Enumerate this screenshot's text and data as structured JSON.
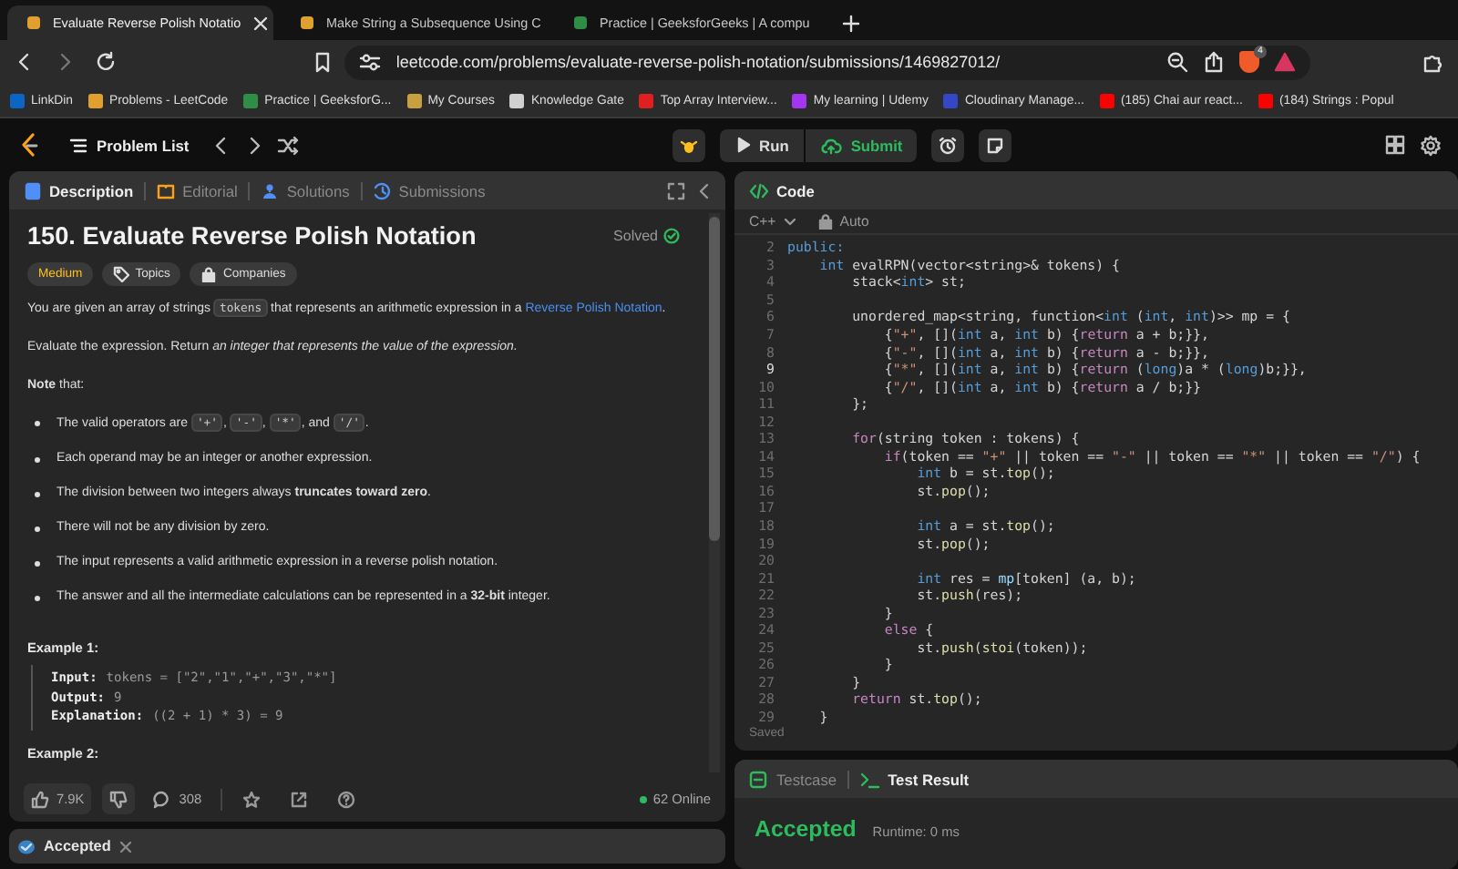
{
  "browser": {
    "tabs": [
      {
        "title": "Evaluate Reverse Polish Notatio",
        "selected": true,
        "color": "#e0a030"
      },
      {
        "title": "Make String a Subsequence Using C",
        "selected": false,
        "color": "#e0a030"
      },
      {
        "title": "Practice | GeeksforGeeks | A compu",
        "selected": false,
        "color": "#2f8d46"
      }
    ],
    "address": "leetcode.com/problems/evaluate-reverse-polish-notation/submissions/1469827012/",
    "shield_badge": "4",
    "bookmarks": [
      {
        "label": "LinkDin",
        "color": "#0a66c2"
      },
      {
        "label": "Problems - LeetCode",
        "color": "#e0a030"
      },
      {
        "label": "Practice | GeeksforG...",
        "color": "#2f8d46"
      },
      {
        "label": "My Courses",
        "color": "#c8a040"
      },
      {
        "label": "Knowledge Gate",
        "color": "#d0d0d0"
      },
      {
        "label": "Top Array Interview...",
        "color": "#e02020"
      },
      {
        "label": "My learning | Udemy",
        "color": "#a435f0"
      },
      {
        "label": "Cloudinary Manage...",
        "color": "#3448c5"
      },
      {
        "label": "(185) Chai aur react...",
        "color": "#ff0000"
      },
      {
        "label": "(184) Strings : Popul",
        "color": "#ff0000"
      }
    ]
  },
  "app_bar": {
    "problem_list": "Problem List",
    "run": "Run",
    "submit": "Submit"
  },
  "description_panel": {
    "tabs": [
      {
        "label": "Description",
        "selected": true
      },
      {
        "label": "Editorial",
        "selected": false
      },
      {
        "label": "Solutions",
        "selected": false
      },
      {
        "label": "Submissions",
        "selected": false
      }
    ],
    "title": "150. Evaluate Reverse Polish Notation",
    "status": "Solved",
    "tags": [
      {
        "kind": "difficulty",
        "label": "Medium"
      },
      {
        "kind": "topics",
        "label": "Topics"
      },
      {
        "kind": "companies",
        "label": "Companies"
      }
    ],
    "body": [
      {
        "kind": "paragraph",
        "segments": [
          "You are given an array of strings ",
          {
            "kind": "code",
            "text": "tokens"
          },
          " that represents an arithmetic expression in a ",
          {
            "kind": "link",
            "text": "Reverse Polish Notation"
          },
          "."
        ]
      },
      {
        "kind": "paragraph",
        "segments": [
          "Evaluate the expression. Return ",
          {
            "kind": "italic",
            "text": "an integer that represents the value of the expression."
          }
        ]
      },
      {
        "kind": "paragraph",
        "segments": [
          {
            "kind": "bold",
            "text": "Note"
          },
          " that:"
        ]
      },
      {
        "kind": "list",
        "items": [
          [
            "The valid operators are ",
            {
              "kind": "code",
              "text": "'+'"
            },
            ", ",
            {
              "kind": "code",
              "text": "'-'"
            },
            ", ",
            {
              "kind": "code",
              "text": "'*'"
            },
            ", and ",
            {
              "kind": "code",
              "text": "'/'"
            },
            "."
          ],
          [
            "Each operand may be an integer or another expression."
          ],
          [
            "The division between two integers always ",
            {
              "kind": "bold",
              "text": "truncates toward zero"
            },
            "."
          ],
          [
            "There will not be any division by zero."
          ],
          [
            "The input represents a valid arithmetic expression in a reverse polish notation."
          ],
          [
            "The answer and all the intermediate calculations can be represented in a ",
            {
              "kind": "bold",
              "text": "32-bit"
            },
            " integer."
          ]
        ]
      },
      {
        "kind": "heading",
        "text": "Example 1:"
      },
      {
        "kind": "example",
        "lines": [
          {
            "label": "Input:",
            "value": "tokens = [\"2\",\"1\",\"+\",\"3\",\"*\"]"
          },
          {
            "label": "Output:",
            "value": "9"
          },
          {
            "label": "Explanation:",
            "value": "((2 + 1) * 3) = 9"
          }
        ]
      },
      {
        "kind": "heading",
        "text": "Example 2:"
      }
    ],
    "footer": {
      "likes": "7.9K",
      "comments": "308",
      "online": "62 Online"
    }
  },
  "result_tab": {
    "label": "Accepted"
  },
  "code_panel": {
    "title": "Code",
    "language": "C++",
    "mode": "Auto",
    "status": "Saved",
    "lines": [
      {
        "number": "2",
        "current": false,
        "segments": [
          {
            "kind": "kw",
            "text": "public:"
          }
        ]
      },
      {
        "number": "3",
        "current": false,
        "segments": [
          {
            "kind": "kw",
            "text": "    int"
          },
          " evalRPN(",
          {
            "kind": "type",
            "text": "vector"
          },
          "<",
          {
            "kind": "type",
            "text": "string"
          },
          ">& tokens) {"
        ]
      },
      {
        "number": "4",
        "current": false,
        "segments": [
          "        stack<",
          {
            "kind": "kw",
            "text": "int"
          },
          "> st;"
        ]
      },
      {
        "number": "5",
        "current": false
      },
      {
        "number": "6",
        "current": false,
        "segments": [
          "        unordered_map<string, function<",
          {
            "kind": "kw",
            "text": "int"
          },
          " (",
          {
            "kind": "kw",
            "text": "int"
          },
          ", ",
          {
            "kind": "kw",
            "text": "int"
          },
          ")>> mp = {"
        ]
      },
      {
        "number": "7",
        "current": false,
        "segments": [
          "            {",
          {
            "kind": "str",
            "text": "\"+\""
          },
          ", [](",
          {
            "kind": "kw",
            "text": "int"
          },
          " a, ",
          {
            "kind": "kw",
            "text": "int"
          },
          " b) {",
          {
            "kind": "ctl",
            "text": "return"
          },
          " a + b;}},"
        ]
      },
      {
        "number": "8",
        "current": false,
        "segments": [
          "            {",
          {
            "kind": "str",
            "text": "\"-\""
          },
          ", [](",
          {
            "kind": "kw",
            "text": "int"
          },
          " a, ",
          {
            "kind": "kw",
            "text": "int"
          },
          " b) {",
          {
            "kind": "ctl",
            "text": "return"
          },
          " a - b;}},"
        ]
      },
      {
        "number": "9",
        "current": true,
        "segments": [
          "            {",
          {
            "kind": "str",
            "text": "\"*\""
          },
          ", [](",
          {
            "kind": "kw",
            "text": "int"
          },
          " a, ",
          {
            "kind": "kw",
            "text": "int"
          },
          " b) {",
          {
            "kind": "ctl",
            "text": "return"
          },
          " (",
          {
            "kind": "kw",
            "text": "long"
          },
          ")a * (",
          {
            "kind": "kw",
            "text": "long"
          },
          ")b;}},"
        ]
      },
      {
        "number": "10",
        "current": false,
        "segments": [
          "            {",
          {
            "kind": "str",
            "text": "\"/\""
          },
          ", [](",
          {
            "kind": "kw",
            "text": "int"
          },
          " a, ",
          {
            "kind": "kw",
            "text": "int"
          },
          " b) {",
          {
            "kind": "ctl",
            "text": "return"
          },
          " a / b;}}"
        ]
      },
      {
        "number": "11",
        "current": false,
        "segments": [
          "        };"
        ]
      },
      {
        "number": "12",
        "current": false
      },
      {
        "number": "13",
        "current": false,
        "segments": [
          {
            "kind": "ctl",
            "text": "        for"
          },
          "(string token : tokens) {"
        ]
      },
      {
        "number": "14",
        "current": false,
        "segments": [
          {
            "kind": "ctl",
            "text": "            if"
          },
          "(token == ",
          {
            "kind": "str",
            "text": "\"+\""
          },
          " || token == ",
          {
            "kind": "str",
            "text": "\"-\""
          },
          " || token == ",
          {
            "kind": "str",
            "text": "\"*\""
          },
          " || token == ",
          {
            "kind": "str",
            "text": "\"/\""
          },
          ") {"
        ]
      },
      {
        "number": "15",
        "current": false,
        "segments": [
          {
            "kind": "kw",
            "text": "                int"
          },
          " b = st.",
          {
            "kind": "fn",
            "text": "top"
          },
          "();"
        ]
      },
      {
        "number": "16",
        "current": false,
        "segments": [
          "                st.",
          {
            "kind": "fn",
            "text": "pop"
          },
          "();"
        ]
      },
      {
        "number": "17",
        "current": false
      },
      {
        "number": "18",
        "current": false,
        "segments": [
          {
            "kind": "kw",
            "text": "                int"
          },
          " a = st.",
          {
            "kind": "fn",
            "text": "top"
          },
          "();"
        ]
      },
      {
        "number": "19",
        "current": false,
        "segments": [
          "                st.",
          {
            "kind": "fn",
            "text": "pop"
          },
          "();"
        ]
      },
      {
        "number": "20",
        "current": false
      },
      {
        "number": "21",
        "current": false,
        "segments": [
          {
            "kind": "kw",
            "text": "                int"
          },
          " res = ",
          {
            "kind": "var",
            "text": "mp"
          },
          "[token] (a, b);"
        ]
      },
      {
        "number": "22",
        "current": false,
        "segments": [
          "                st.",
          {
            "kind": "fn",
            "text": "push"
          },
          "(res);"
        ]
      },
      {
        "number": "23",
        "current": false,
        "segments": [
          "            }"
        ]
      },
      {
        "number": "24",
        "current": false,
        "segments": [
          {
            "kind": "ctl",
            "text": "            else"
          },
          " {"
        ]
      },
      {
        "number": "25",
        "current": false,
        "segments": [
          "                st.",
          {
            "kind": "fn",
            "text": "push"
          },
          "(",
          {
            "kind": "fn",
            "text": "stoi"
          },
          "(token));"
        ]
      },
      {
        "number": "26",
        "current": false,
        "segments": [
          "            }"
        ]
      },
      {
        "number": "27",
        "current": false,
        "segments": [
          "        }"
        ]
      },
      {
        "number": "28",
        "current": false,
        "segments": [
          {
            "kind": "ctl",
            "text": "        return"
          },
          " st.",
          {
            "kind": "fn",
            "text": "top"
          },
          "();"
        ]
      },
      {
        "number": "29",
        "current": false,
        "segments": [
          "    }"
        ]
      }
    ]
  },
  "test_panel": {
    "tabs": [
      {
        "label": "Testcase",
        "selected": false
      },
      {
        "label": "Test Result",
        "selected": true
      }
    ],
    "verdict": "Accepted",
    "runtime": "Runtime: 0 ms"
  }
}
